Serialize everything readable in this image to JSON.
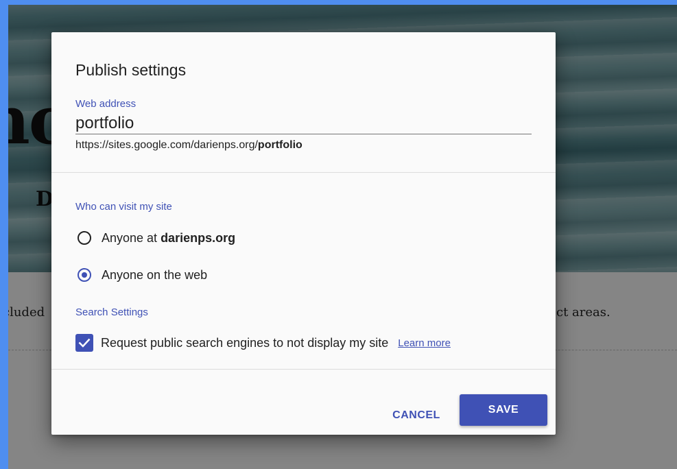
{
  "background": {
    "hero_title_fragment": "no",
    "hero_subtitle_fragment": "D",
    "body_text_left_fragment": "cluded",
    "body_text_right_fragment": "ct areas."
  },
  "dialog": {
    "title": "Publish settings",
    "web_address": {
      "label": "Web address",
      "value": "portfolio",
      "url_prefix": "https://sites.google.com/darienps.org/",
      "url_slug": "portfolio"
    },
    "visibility": {
      "label": "Who can visit my site",
      "options": [
        {
          "prefix": "Anyone at ",
          "bold": "darienps.org",
          "selected": false
        },
        {
          "prefix": "Anyone on the web",
          "bold": "",
          "selected": true
        }
      ]
    },
    "search": {
      "label": "Search Settings",
      "checkbox_label": "Request public search engines to not display my site",
      "checked": true,
      "learn_more": "Learn more"
    },
    "buttons": {
      "cancel": "CANCEL",
      "save": "SAVE"
    }
  },
  "colors": {
    "accent": "#3f51b5",
    "frame": "#4f8ef0"
  }
}
